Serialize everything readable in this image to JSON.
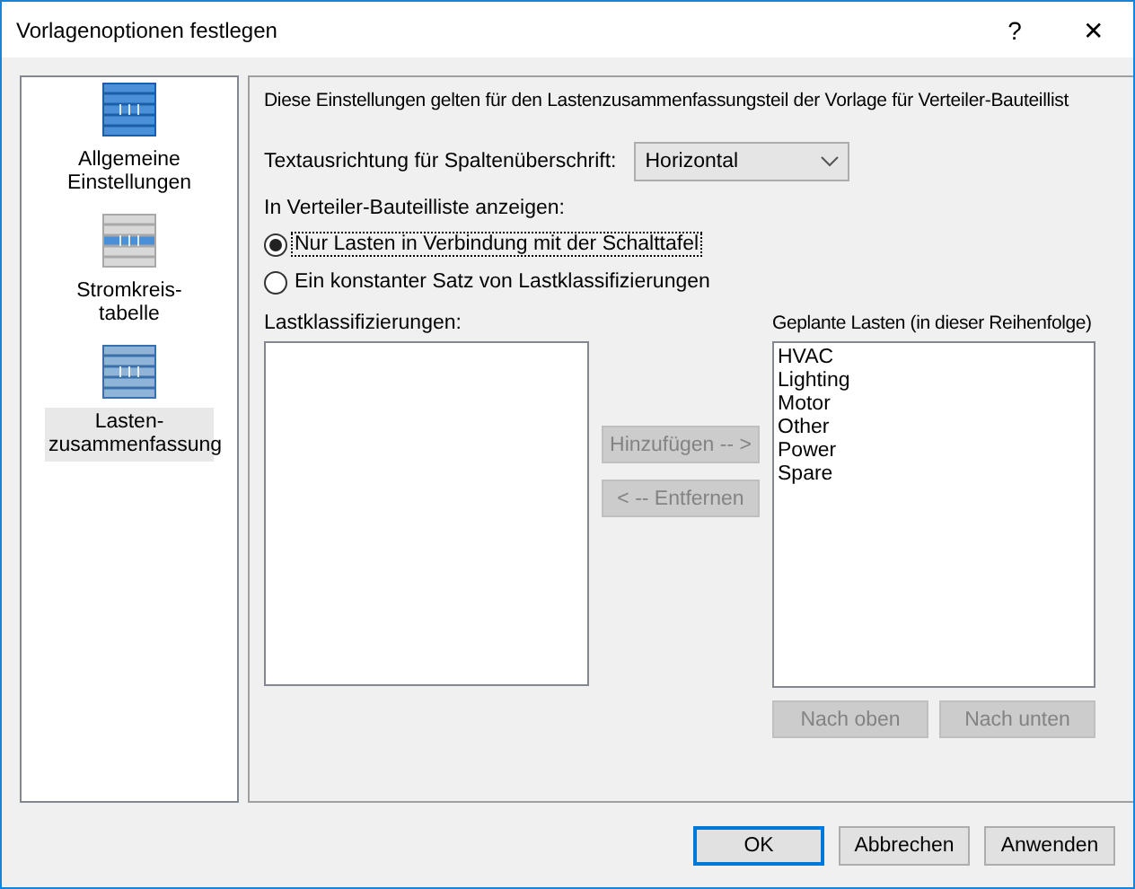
{
  "window": {
    "title": "Vorlagenoptionen festlegen",
    "help": "?",
    "close": "✕"
  },
  "sidebar": {
    "items": [
      {
        "label": "Allgemeine Einstellungen",
        "selected": false
      },
      {
        "label": "Stromkreis-tabelle",
        "selected": false
      },
      {
        "label": "Lasten-zusammenfassung",
        "selected": true
      }
    ]
  },
  "description": "Diese Einstellungen gelten für den Lastenzusammenfassungsteil der Vorlage für Verteiler-Bauteillist",
  "alignment": {
    "label": "Textausrichtung für Spaltenüberschrift:",
    "value": "Horizontal"
  },
  "show_group": {
    "label": "In Verteiler-Bauteilliste anzeigen:",
    "options": [
      {
        "label": "Nur Lasten in Verbindung mit der Schalttafel",
        "selected": true
      },
      {
        "label": "Ein konstanter Satz von Lastklassifizierungen",
        "selected": false
      }
    ]
  },
  "classifications": {
    "label": "Lastklassifizierungen:"
  },
  "middle_buttons": [
    {
      "label": "Hinzufügen -- >",
      "disabled": true
    },
    {
      "label": "< -- Entfernen",
      "disabled": true
    }
  ],
  "planned": {
    "label": "Geplante Lasten (in dieser Reihenfolge)",
    "items": [
      "HVAC",
      "Lighting",
      "Motor",
      "Other",
      "Power",
      "Spare"
    ]
  },
  "order_buttons": [
    {
      "label": "Nach oben",
      "disabled": true
    },
    {
      "label": "Nach unten",
      "disabled": true
    }
  ],
  "footer_buttons": [
    {
      "label": "OK",
      "default": true
    },
    {
      "label": "Abbrechen",
      "default": false
    },
    {
      "label": "Anwenden",
      "default": false
    }
  ]
}
